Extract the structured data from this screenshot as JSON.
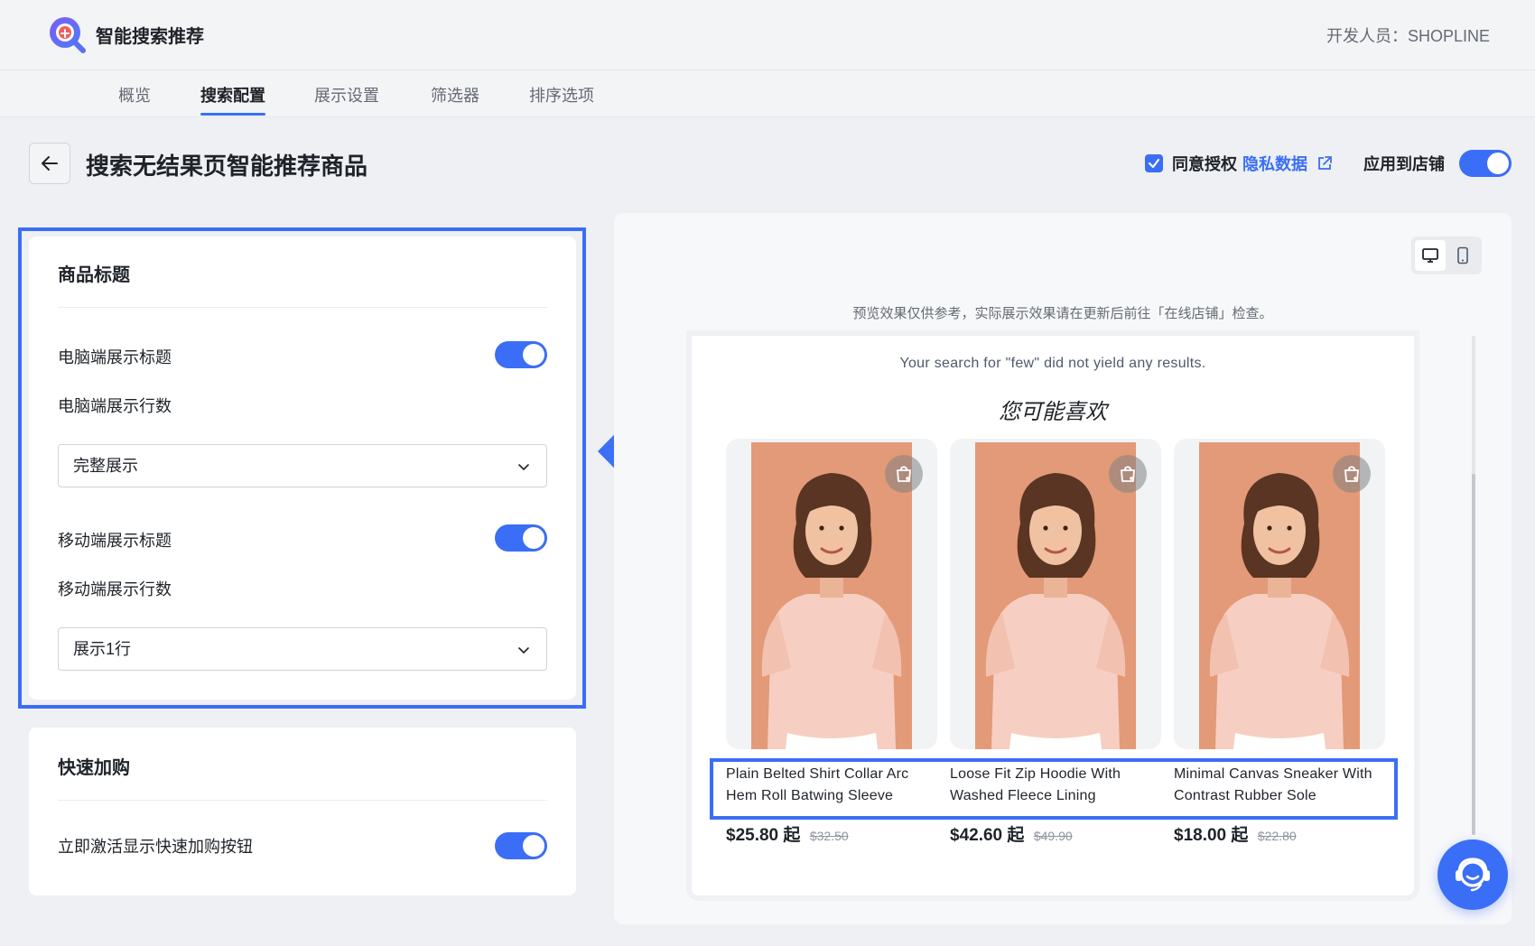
{
  "app": {
    "name": "智能搜索推荐",
    "developer": "开发人员：SHOPLINE"
  },
  "tabs": [
    {
      "label": "概览"
    },
    {
      "label": "搜索配置",
      "active": true
    },
    {
      "label": "展示设置"
    },
    {
      "label": "筛选器"
    },
    {
      "label": "排序选项"
    }
  ],
  "page": {
    "title": "搜索无结果页智能推荐商品",
    "agree_text": "同意授权",
    "privacy_link": "隐私数据",
    "apply_label": "应用到店铺",
    "apply_enabled": true,
    "agree_checked": true
  },
  "title_card": {
    "title": "商品标题",
    "desktop_show_label": "电脑端展示标题",
    "desktop_show_enabled": true,
    "desktop_rows_label": "电脑端展示行数",
    "desktop_rows_value": "完整展示",
    "mobile_show_label": "移动端展示标题",
    "mobile_show_enabled": true,
    "mobile_rows_label": "移动端展示行数",
    "mobile_rows_value": "展示1行"
  },
  "quick_card": {
    "title": "快速加购",
    "activate_label": "立即激活显示快速加购按钮",
    "activate_enabled": true
  },
  "preview": {
    "note": "预览效果仅供参考，实际展示效果请在更新后前往「在线店铺」检查。",
    "search_message": "Your search for \"few\" did not yield any results.",
    "recommend_title": "您可能喜欢",
    "device_active": "desktop",
    "products": [
      {
        "name": "Plain Belted Shirt Collar Arc Hem Roll Batwing Sleeve",
        "price": "$25.80 起",
        "old_price": "$32.50"
      },
      {
        "name": "Loose Fit Zip Hoodie With Washed Fleece Lining",
        "price": "$42.60 起",
        "old_price": "$49.90"
      },
      {
        "name": "Minimal Canvas Sneaker With Contrast Rubber Sole",
        "price": "$18.00 起",
        "old_price": "$22.80"
      }
    ]
  },
  "colors": {
    "accent": "#3b6ef6",
    "background": "#eef0f4",
    "photo_background": "#e39a78",
    "shirt": "#f6cfc2"
  }
}
